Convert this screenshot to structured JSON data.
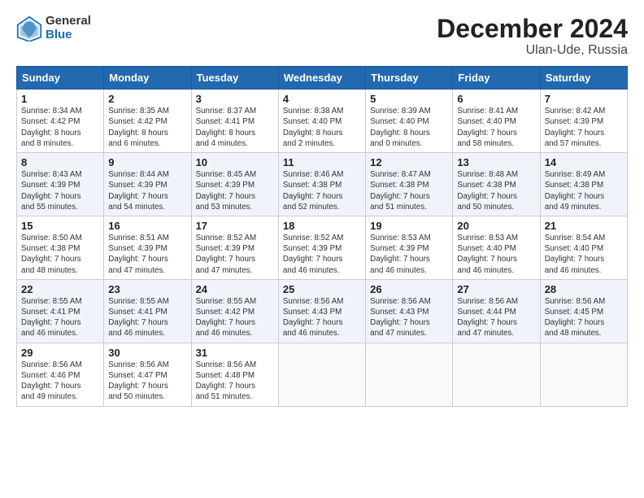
{
  "logo": {
    "line1": "General",
    "line2": "Blue"
  },
  "title": "December 2024",
  "subtitle": "Ulan-Ude, Russia",
  "weekdays": [
    "Sunday",
    "Monday",
    "Tuesday",
    "Wednesday",
    "Thursday",
    "Friday",
    "Saturday"
  ],
  "weeks": [
    [
      {
        "day": "1",
        "detail": "Sunrise: 8:34 AM\nSunset: 4:42 PM\nDaylight: 8 hours\nand 8 minutes."
      },
      {
        "day": "2",
        "detail": "Sunrise: 8:35 AM\nSunset: 4:42 PM\nDaylight: 8 hours\nand 6 minutes."
      },
      {
        "day": "3",
        "detail": "Sunrise: 8:37 AM\nSunset: 4:41 PM\nDaylight: 8 hours\nand 4 minutes."
      },
      {
        "day": "4",
        "detail": "Sunrise: 8:38 AM\nSunset: 4:40 PM\nDaylight: 8 hours\nand 2 minutes."
      },
      {
        "day": "5",
        "detail": "Sunrise: 8:39 AM\nSunset: 4:40 PM\nDaylight: 8 hours\nand 0 minutes."
      },
      {
        "day": "6",
        "detail": "Sunrise: 8:41 AM\nSunset: 4:40 PM\nDaylight: 7 hours\nand 58 minutes."
      },
      {
        "day": "7",
        "detail": "Sunrise: 8:42 AM\nSunset: 4:39 PM\nDaylight: 7 hours\nand 57 minutes."
      }
    ],
    [
      {
        "day": "8",
        "detail": "Sunrise: 8:43 AM\nSunset: 4:39 PM\nDaylight: 7 hours\nand 55 minutes."
      },
      {
        "day": "9",
        "detail": "Sunrise: 8:44 AM\nSunset: 4:39 PM\nDaylight: 7 hours\nand 54 minutes."
      },
      {
        "day": "10",
        "detail": "Sunrise: 8:45 AM\nSunset: 4:39 PM\nDaylight: 7 hours\nand 53 minutes."
      },
      {
        "day": "11",
        "detail": "Sunrise: 8:46 AM\nSunset: 4:38 PM\nDaylight: 7 hours\nand 52 minutes."
      },
      {
        "day": "12",
        "detail": "Sunrise: 8:47 AM\nSunset: 4:38 PM\nDaylight: 7 hours\nand 51 minutes."
      },
      {
        "day": "13",
        "detail": "Sunrise: 8:48 AM\nSunset: 4:38 PM\nDaylight: 7 hours\nand 50 minutes."
      },
      {
        "day": "14",
        "detail": "Sunrise: 8:49 AM\nSunset: 4:38 PM\nDaylight: 7 hours\nand 49 minutes."
      }
    ],
    [
      {
        "day": "15",
        "detail": "Sunrise: 8:50 AM\nSunset: 4:38 PM\nDaylight: 7 hours\nand 48 minutes."
      },
      {
        "day": "16",
        "detail": "Sunrise: 8:51 AM\nSunset: 4:39 PM\nDaylight: 7 hours\nand 47 minutes."
      },
      {
        "day": "17",
        "detail": "Sunrise: 8:52 AM\nSunset: 4:39 PM\nDaylight: 7 hours\nand 47 minutes."
      },
      {
        "day": "18",
        "detail": "Sunrise: 8:52 AM\nSunset: 4:39 PM\nDaylight: 7 hours\nand 46 minutes."
      },
      {
        "day": "19",
        "detail": "Sunrise: 8:53 AM\nSunset: 4:39 PM\nDaylight: 7 hours\nand 46 minutes."
      },
      {
        "day": "20",
        "detail": "Sunrise: 8:53 AM\nSunset: 4:40 PM\nDaylight: 7 hours\nand 46 minutes."
      },
      {
        "day": "21",
        "detail": "Sunrise: 8:54 AM\nSunset: 4:40 PM\nDaylight: 7 hours\nand 46 minutes."
      }
    ],
    [
      {
        "day": "22",
        "detail": "Sunrise: 8:55 AM\nSunset: 4:41 PM\nDaylight: 7 hours\nand 46 minutes."
      },
      {
        "day": "23",
        "detail": "Sunrise: 8:55 AM\nSunset: 4:41 PM\nDaylight: 7 hours\nand 46 minutes."
      },
      {
        "day": "24",
        "detail": "Sunrise: 8:55 AM\nSunset: 4:42 PM\nDaylight: 7 hours\nand 46 minutes."
      },
      {
        "day": "25",
        "detail": "Sunrise: 8:56 AM\nSunset: 4:43 PM\nDaylight: 7 hours\nand 46 minutes."
      },
      {
        "day": "26",
        "detail": "Sunrise: 8:56 AM\nSunset: 4:43 PM\nDaylight: 7 hours\nand 47 minutes."
      },
      {
        "day": "27",
        "detail": "Sunrise: 8:56 AM\nSunset: 4:44 PM\nDaylight: 7 hours\nand 47 minutes."
      },
      {
        "day": "28",
        "detail": "Sunrise: 8:56 AM\nSunset: 4:45 PM\nDaylight: 7 hours\nand 48 minutes."
      }
    ],
    [
      {
        "day": "29",
        "detail": "Sunrise: 8:56 AM\nSunset: 4:46 PM\nDaylight: 7 hours\nand 49 minutes."
      },
      {
        "day": "30",
        "detail": "Sunrise: 8:56 AM\nSunset: 4:47 PM\nDaylight: 7 hours\nand 50 minutes."
      },
      {
        "day": "31",
        "detail": "Sunrise: 8:56 AM\nSunset: 4:48 PM\nDaylight: 7 hours\nand 51 minutes."
      },
      {
        "day": "",
        "detail": ""
      },
      {
        "day": "",
        "detail": ""
      },
      {
        "day": "",
        "detail": ""
      },
      {
        "day": "",
        "detail": ""
      }
    ]
  ]
}
